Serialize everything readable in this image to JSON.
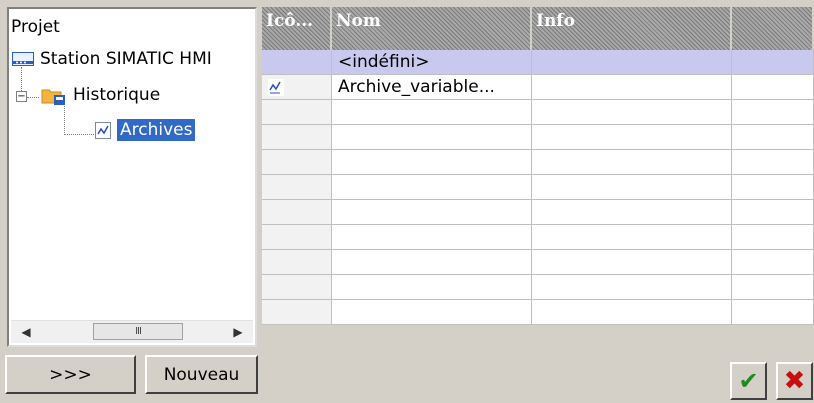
{
  "tree": {
    "root_label": "Projet",
    "items": [
      {
        "label": "Station SIMATIC HMI",
        "icon": "station-icon"
      },
      {
        "label": "Historique",
        "icon": "folder-archive-icon"
      },
      {
        "label": "Archives",
        "icon": "archive-icon",
        "selected": true
      }
    ]
  },
  "buttons": {
    "more_label": ">>>",
    "new_label": "Nouveau",
    "ok_glyph": "✔",
    "cancel_glyph": "✖"
  },
  "grid": {
    "columns": [
      "Icô...",
      "Nom",
      "Info",
      ""
    ],
    "rows": [
      {
        "icon": "",
        "name": "<indéfini>",
        "info": "",
        "new": true
      },
      {
        "icon": "archive-icon",
        "name": "Archive_variable...",
        "info": ""
      }
    ],
    "empty_rows": 9
  },
  "colors": {
    "selection": "#3169c6",
    "new_row": "#c9c8ee",
    "ok": "#208a20",
    "cancel": "#c41010"
  }
}
